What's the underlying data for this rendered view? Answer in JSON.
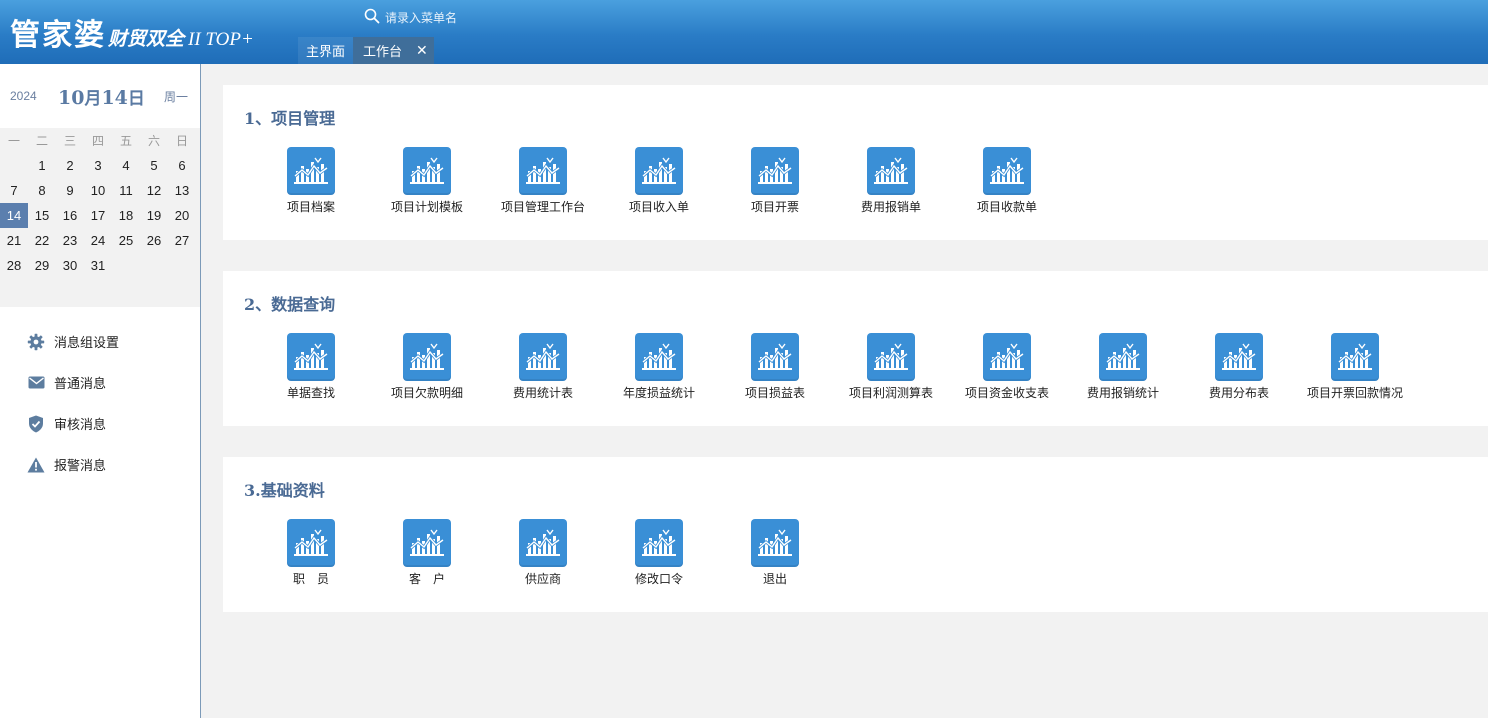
{
  "app": {
    "logo_main": "管家婆",
    "logo_sub": "财贸双全",
    "logo_version": "II TOP+"
  },
  "search": {
    "placeholder": "请录入菜单名"
  },
  "tabs": [
    {
      "label": "主界面"
    },
    {
      "label": "工作台",
      "close": "✕"
    }
  ],
  "date": {
    "year": "2024",
    "month": "10",
    "month_unit": "月",
    "day": "14",
    "day_unit": "日",
    "weekday": "周一"
  },
  "calendar": {
    "weekdays": [
      "一",
      "二",
      "三",
      "四",
      "五",
      "六",
      "日"
    ],
    "weeks": [
      [
        "",
        "1",
        "2",
        "3",
        "4",
        "5",
        "6"
      ],
      [
        "7",
        "8",
        "9",
        "10",
        "11",
        "12",
        "13"
      ],
      [
        "14",
        "15",
        "16",
        "17",
        "18",
        "19",
        "20"
      ],
      [
        "21",
        "22",
        "23",
        "24",
        "25",
        "26",
        "27"
      ],
      [
        "28",
        "29",
        "30",
        "31",
        "",
        "",
        ""
      ]
    ],
    "today": "14"
  },
  "messages": [
    {
      "label": "消息组设置",
      "icon": "gear-icon"
    },
    {
      "label": "普通消息",
      "icon": "envelope-icon"
    },
    {
      "label": "审核消息",
      "icon": "shield-check-icon"
    },
    {
      "label": "报警消息",
      "icon": "warning-icon"
    }
  ],
  "sections": [
    {
      "title": "1、项目管理",
      "items": [
        "项目档案",
        "项目计划模板",
        "项目管理工作台",
        "项目收入单",
        "项目开票",
        "费用报销单",
        "项目收款单"
      ]
    },
    {
      "title": "2、数据查询",
      "items": [
        "单据查找",
        "项目欠款明细",
        "费用统计表",
        "年度损益统计",
        "项目损益表",
        "项目利润测算表",
        "项目资金收支表",
        "费用报销统计",
        "费用分布表",
        "项目开票回款情况"
      ]
    },
    {
      "title": "3.基础资料",
      "items": [
        "职　员",
        "客　户",
        "供应商",
        "修改口令",
        "退出"
      ]
    }
  ],
  "colors": {
    "header": "#2a7cc6",
    "icon_tile": "#3a8fd6",
    "today_highlight": "#5b7fae",
    "section_title": "#4a6a94"
  }
}
